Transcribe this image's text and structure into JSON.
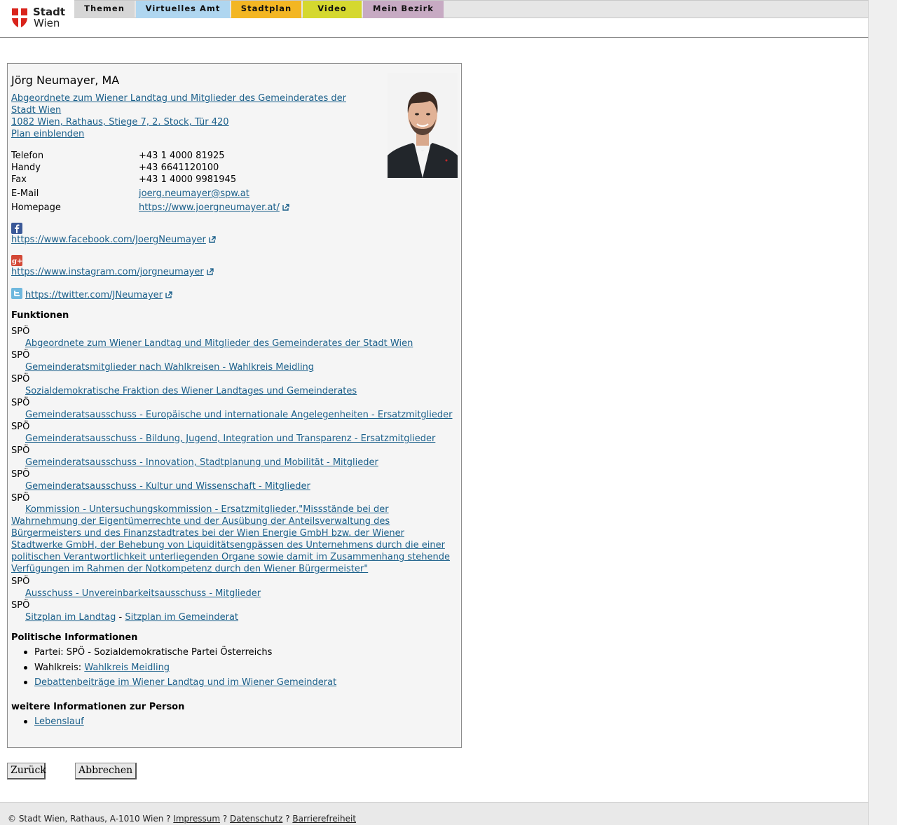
{
  "header": {
    "logo_line1": "Stadt",
    "logo_line2": "Wien",
    "tabs": [
      {
        "label": "Themen"
      },
      {
        "label": "Virtuelles Amt"
      },
      {
        "label": "Stadtplan"
      },
      {
        "label": "Video"
      },
      {
        "label": "Mein Bezirk"
      }
    ]
  },
  "person": {
    "name": "Jörg Neumayer, MA",
    "role_link": "Abgeordnete zum Wiener Landtag und Mitglieder des Gemeinderates der Stadt Wien ",
    "address_link": "1082 Wien, Rathaus, Stiege 7, 2. Stock, Tür 420",
    "plan_link": "Plan einblenden",
    "contacts": [
      {
        "label": "Telefon",
        "value": "+43 1 4000 81925"
      },
      {
        "label": "Handy",
        "value": "+43 6641120100"
      },
      {
        "label": "Fax",
        "value": "+43 1 4000 9981945"
      },
      {
        "label": "E-Mail",
        "value": "joerg.neumayer@spw.at"
      },
      {
        "label": "Homepage",
        "value": "https://www.joergneumayer.at/"
      }
    ],
    "social": {
      "facebook": "https://www.facebook.com/JoergNeumayer",
      "instagram": "https://www.instagram.com/jorgneumayer",
      "twitter": "https://twitter.com/JNeumayer"
    }
  },
  "funktionen": {
    "heading": "Funktionen",
    "party": "SPÖ",
    "items": [
      "Abgeordnete zum Wiener Landtag und Mitglieder des Gemeinderates der Stadt Wien",
      "Gemeinderatsmitglieder nach Wahlkreisen - Wahlkreis Meidling",
      "Sozialdemokratische Fraktion des Wiener Landtages und Gemeinderates",
      "Gemeinderatsausschuss - Europäische und internationale Angelegenheiten - Ersatzmitglieder",
      "Gemeinderatsausschuss - Bildung, Jugend, Integration und Transparenz - Ersatzmitglieder",
      "Gemeinderatsausschuss - Innovation, Stadtplanung und Mobilität - Mitglieder",
      "Gemeinderatsausschuss - Kultur und Wissenschaft - Mitglieder"
    ],
    "commission": "Kommission - Untersuchungskommission - Ersatzmitglieder,\"Missstände bei der Wahrnehmung der Eigentümerrechte und der Ausübung der Anteilsverwaltung des Bürgermeisters und des Finanzstadtrates bei der Wien Energie GmbH bzw. der Wiener Stadtwerke GmbH, der Behebung von Liquiditätsengpässen des Unternehmens durch die einer politischen Verantwortlichkeit unterliegenden Organe sowie damit im Zusammenhang stehende Verfügungen im Rahmen der Notkompetenz durch den Wiener Bürgermeister\"",
    "ausschuss": "Ausschuss - Unvereinbarkeitsausschuss - Mitglieder",
    "sitzplan_landtag": "Sitzplan im Landtag",
    "separator": " - ",
    "sitzplan_gemeinderat": "Sitzplan im Gemeinderat"
  },
  "politisch": {
    "heading": "Politische Informationen",
    "partei": "Partei: SPÖ - Sozialdemokratische Partei Österreichs",
    "wahlkreis_label": "Wahlkreis: ",
    "wahlkreis_link": "Wahlkreis Meidling",
    "debatten_link": "Debattenbeiträge im Wiener Landtag und im Wiener Gemeinderat"
  },
  "weitere": {
    "heading": "weitere Informationen zur Person",
    "lebenslauf": "Lebenslauf"
  },
  "buttons": {
    "back": "Zurück",
    "cancel": "Abbrechen"
  },
  "footer": {
    "copyright": "© Stadt Wien, Rathaus, A-1010 Wien ? ",
    "impressum": "Impressum",
    "sep1": " ? ",
    "datenschutz": "Datenschutz",
    "sep2": " ? ",
    "barrierefreiheit": "Barrierefreiheit"
  },
  "colors": {
    "link": "#1a5f8a",
    "tab_themen": "#d6d6d6",
    "tab_amt": "#afd6f0",
    "tab_stadtplan": "#f3b623",
    "tab_video": "#d5d82f",
    "tab_bezirk": "#c7aac3"
  }
}
